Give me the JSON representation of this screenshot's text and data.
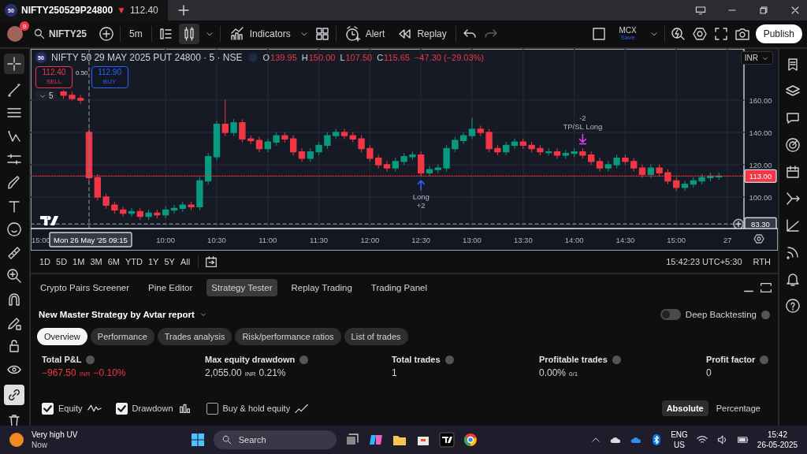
{
  "browser_tab": {
    "logo": "50",
    "title": "NIFTY250529P24800",
    "arrow": "▼",
    "price": "112.40"
  },
  "toolbar": {
    "avatar_badge": "9",
    "symbol": "NIFTY25",
    "interval": "5m",
    "indicators": "Indicators",
    "alert": "Alert",
    "replay": "Replay",
    "layout_name": "MCX",
    "layout_status": "Save",
    "publish": "Publish"
  },
  "legend": {
    "logo": "50",
    "title": "NIFTY 50 29 MAY 2025 PUT 24800 · 5 · NSE",
    "ohlc": [
      {
        "label": "O",
        "value": "139.95"
      },
      {
        "label": "H",
        "value": "150.00"
      },
      {
        "label": "L",
        "value": "107.50"
      },
      {
        "label": "C",
        "value": "115.65"
      }
    ],
    "change": "−47.30 (−29.03%)"
  },
  "currency": "INR",
  "order_panel": {
    "sell_price": "112.40",
    "sell_label": "SELL",
    "spread": "0.50",
    "buy_price": "112.90",
    "buy_label": "BUY",
    "collapse_count": "5"
  },
  "chart": {
    "chart_data": {
      "type": "candlestick",
      "categories": [
        "15:00",
        null,
        null,
        null,
        null,
        null,
        null,
        null,
        null,
        null,
        null,
        null,
        null,
        null,
        null,
        "10:00",
        null,
        null,
        null,
        null,
        null,
        "10:30",
        null,
        null,
        null,
        null,
        null,
        "11:00",
        null,
        null,
        null,
        null,
        null,
        "11:30",
        null,
        null,
        null,
        null,
        null,
        "12:00",
        null,
        null,
        null,
        null,
        null,
        "12:30",
        null,
        null,
        null,
        null,
        null,
        "13:00",
        null,
        null,
        null,
        null,
        null,
        "13:30",
        null,
        null,
        null,
        null,
        null,
        "14:00",
        null,
        null,
        null,
        null,
        null,
        "14:30",
        null,
        null,
        null,
        null,
        null,
        "15:00",
        null,
        null,
        null,
        null,
        null,
        "27"
      ],
      "ohlc": [
        null,
        null,
        null,
        [
          165,
          166,
          161,
          163
        ],
        [
          163,
          165,
          160,
          161
        ],
        [
          161,
          163,
          158,
          160
        ],
        [
          140,
          142,
          110,
          112
        ],
        [
          112,
          114,
          98,
          100
        ],
        [
          100,
          102,
          93,
          95
        ],
        [
          95,
          97,
          90,
          92
        ],
        [
          92,
          94,
          88,
          90
        ],
        [
          90,
          93,
          88,
          91
        ],
        [
          91,
          93,
          86,
          88
        ],
        [
          88,
          92,
          86,
          90
        ],
        [
          90,
          92,
          87,
          89
        ],
        [
          89,
          94,
          87,
          92
        ],
        [
          92,
          95,
          90,
          93
        ],
        [
          93,
          97,
          91,
          95
        ],
        [
          95,
          97,
          92,
          94
        ],
        [
          94,
          112,
          92,
          110
        ],
        [
          110,
          127,
          108,
          125
        ],
        [
          125,
          147,
          123,
          145
        ],
        [
          145,
          160,
          138,
          140
        ],
        [
          140,
          148,
          138,
          146
        ],
        [
          146,
          148,
          134,
          136
        ],
        [
          136,
          138,
          133,
          135
        ],
        [
          135,
          137,
          128,
          130
        ],
        [
          130,
          136,
          128,
          134
        ],
        [
          134,
          140,
          132,
          138
        ],
        [
          138,
          140,
          134,
          136
        ],
        [
          136,
          138,
          126,
          128
        ],
        [
          128,
          130,
          122,
          124
        ],
        [
          124,
          130,
          122,
          128
        ],
        [
          128,
          134,
          126,
          132
        ],
        [
          132,
          140,
          130,
          138
        ],
        [
          138,
          142,
          136,
          140
        ],
        [
          140,
          142,
          136,
          138
        ],
        [
          138,
          140,
          134,
          136
        ],
        [
          136,
          138,
          128,
          130
        ],
        [
          130,
          132,
          122,
          124
        ],
        [
          124,
          126,
          118,
          120
        ],
        [
          120,
          122,
          116,
          118
        ],
        [
          118,
          124,
          116,
          122
        ],
        [
          122,
          127,
          120,
          125
        ],
        [
          125,
          128,
          123,
          126
        ],
        [
          126,
          128,
          113,
          115
        ],
        [
          115,
          119,
          113,
          117
        ],
        [
          117,
          120,
          115,
          118
        ],
        [
          118,
          132,
          116,
          130
        ],
        [
          130,
          137,
          128,
          135
        ],
        [
          135,
          140,
          133,
          138
        ],
        [
          138,
          149,
          136,
          142
        ],
        [
          142,
          144,
          138,
          140
        ],
        [
          140,
          142,
          128,
          130
        ],
        [
          130,
          132,
          126,
          128
        ],
        [
          128,
          134,
          126,
          132
        ],
        [
          132,
          136,
          130,
          134
        ],
        [
          134,
          136,
          130,
          132
        ],
        [
          132,
          134,
          128,
          130
        ],
        [
          130,
          132,
          126,
          128
        ],
        [
          128,
          130,
          126,
          128
        ],
        [
          128,
          130,
          124,
          126
        ],
        [
          126,
          129,
          124,
          127
        ],
        [
          127,
          130,
          125,
          128
        ],
        [
          128,
          130,
          124,
          126
        ],
        [
          126,
          128,
          120,
          122
        ],
        [
          122,
          124,
          116,
          118
        ],
        [
          118,
          122,
          116,
          120
        ],
        [
          120,
          126,
          118,
          124
        ],
        [
          124,
          126,
          120,
          122
        ],
        [
          122,
          124,
          116,
          118
        ],
        [
          118,
          120,
          112,
          114
        ],
        [
          114,
          120,
          112,
          118
        ],
        [
          118,
          120,
          113,
          115
        ],
        [
          115,
          117,
          108,
          110
        ],
        [
          110,
          112,
          104,
          106
        ],
        [
          106,
          110,
          104,
          108
        ],
        [
          108,
          112,
          106,
          110
        ],
        [
          110,
          114,
          108,
          112
        ],
        [
          112,
          115,
          110,
          113
        ],
        [
          113,
          115,
          111,
          113
        ],
        null
      ],
      "ylim": [
        80.5,
        191.7
      ],
      "yticks": [
        {
          "value": 160,
          "label": "160.00"
        },
        {
          "value": 140,
          "label": "140.00"
        },
        {
          "value": 120,
          "label": "120.00"
        },
        {
          "value": 100,
          "label": "100.00"
        }
      ],
      "grid": true,
      "ref_lines": [
        {
          "axis": "y",
          "value": 113,
          "label": "113.00",
          "color": "#f23645"
        },
        {
          "axis": "y",
          "value": 83.3,
          "label": "83.30",
          "color": "#787b86"
        }
      ]
    },
    "crosshair": {
      "date": "Mon 26 May '25",
      "time": "09:15"
    },
    "trade_markers": [
      {
        "kind": "entry",
        "label": "Long",
        "quantity": "+2"
      },
      {
        "kind": "exit",
        "label": "TP/SL Long",
        "quantity": "-2"
      }
    ]
  },
  "range_bar": {
    "ranges": [
      "1D",
      "5D",
      "1M",
      "3M",
      "6M",
      "YTD",
      "1Y",
      "5Y",
      "All"
    ],
    "clock": "15:42:23 UTC+5:30",
    "session": "RTH"
  },
  "panel": {
    "tabs": [
      {
        "label": "Crypto Pairs Screener",
        "selected": false
      },
      {
        "label": "Pine Editor",
        "selected": false
      },
      {
        "label": "Strategy Tester",
        "selected": true
      },
      {
        "label": "Replay Trading",
        "selected": false
      },
      {
        "label": "Trading Panel",
        "selected": false
      }
    ],
    "report_title": "New Master Strategy by Avtar report",
    "deep_backtesting": {
      "label": "Deep Backtesting",
      "on": false
    },
    "report_tabs": [
      {
        "label": "Overview",
        "selected": true
      },
      {
        "label": "Performance",
        "selected": false
      },
      {
        "label": "Trades analysis",
        "selected": false
      },
      {
        "label": "Risk/performance ratios",
        "selected": false
      },
      {
        "label": "List of trades",
        "selected": false
      }
    ],
    "metrics": [
      {
        "label": "Total P&L",
        "value": "−967.50",
        "unit": "INR",
        "extra": "−0.10%",
        "negative": true
      },
      {
        "label": "Max equity drawdown",
        "value": "2,055.00",
        "unit": "INR",
        "extra": "0.21%",
        "negative": false
      },
      {
        "label": "Total trades",
        "value": "1",
        "negative": false
      },
      {
        "label": "Profitable trades",
        "value": "0.00%",
        "unit": "0/1",
        "negative": false
      },
      {
        "label": "Profit factor",
        "value": "0",
        "negative": false
      }
    ],
    "series_toggles": [
      {
        "label": "Equity",
        "checked": true
      },
      {
        "label": "Drawdown",
        "checked": true
      },
      {
        "label": "Buy & hold equity",
        "checked": false
      }
    ],
    "scale_modes": [
      {
        "label": "Absolute",
        "selected": true
      },
      {
        "label": "Percentage",
        "selected": false
      }
    ]
  },
  "taskbar": {
    "weather_title": "Very high UV",
    "weather_sub": "Now",
    "search": "Search",
    "language": "ENG",
    "region": "US",
    "time": "15:42",
    "date": "26-05-2025"
  }
}
